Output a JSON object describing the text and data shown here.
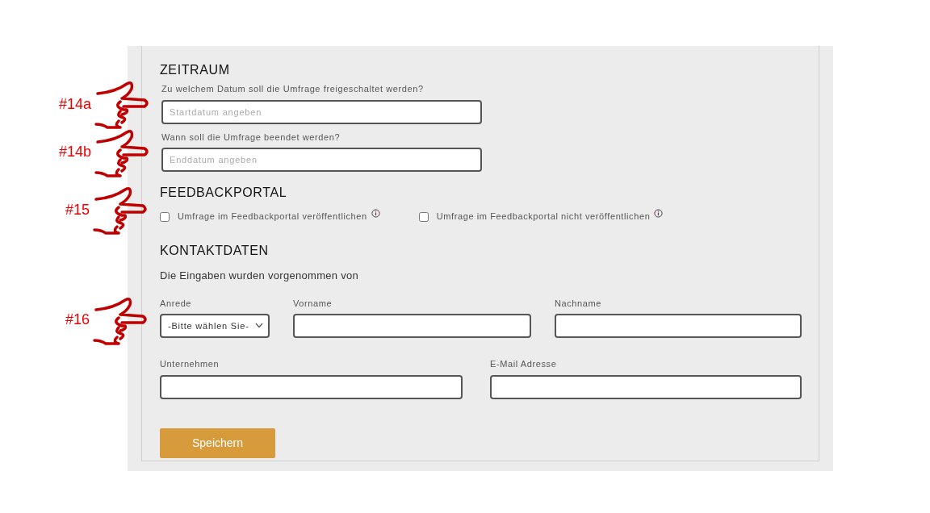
{
  "zeitraum": {
    "heading": "ZEITRAUM",
    "fields": [
      {
        "label": "Zu welchem Datum soll die Umfrage freigeschaltet werden?",
        "placeholder": "Startdatum angeben",
        "annotation": "#14a"
      },
      {
        "label": "Wann soll die Umfrage beendet werden?",
        "placeholder": "Enddatum angeben",
        "annotation": "#14b"
      }
    ]
  },
  "feedbackportal": {
    "heading": "FEEDBACKPORTAL",
    "annotation": "#15",
    "options": [
      {
        "label": "Umfrage im Feedbackportal veröffentlichen",
        "checked": false
      },
      {
        "label": "Umfrage im Feedbackportal nicht veröffentlichen",
        "checked": false
      }
    ]
  },
  "kontaktdaten": {
    "heading": "KONTAKTDATEN",
    "intro": "Die Eingaben wurden vorgenommen von",
    "rows": [
      [
        {
          "kind": "select",
          "label": "Anrede",
          "value": "-Bitte wählen Sie-",
          "annotation": "#16"
        },
        {
          "kind": "text",
          "label": "Vorname"
        },
        {
          "kind": "text",
          "label": "Nachname"
        }
      ],
      [
        {
          "kind": "text",
          "label": "Unternehmen"
        },
        {
          "kind": "text",
          "label": "E-Mail Adresse"
        }
      ]
    ]
  },
  "save_button": "Speichern"
}
